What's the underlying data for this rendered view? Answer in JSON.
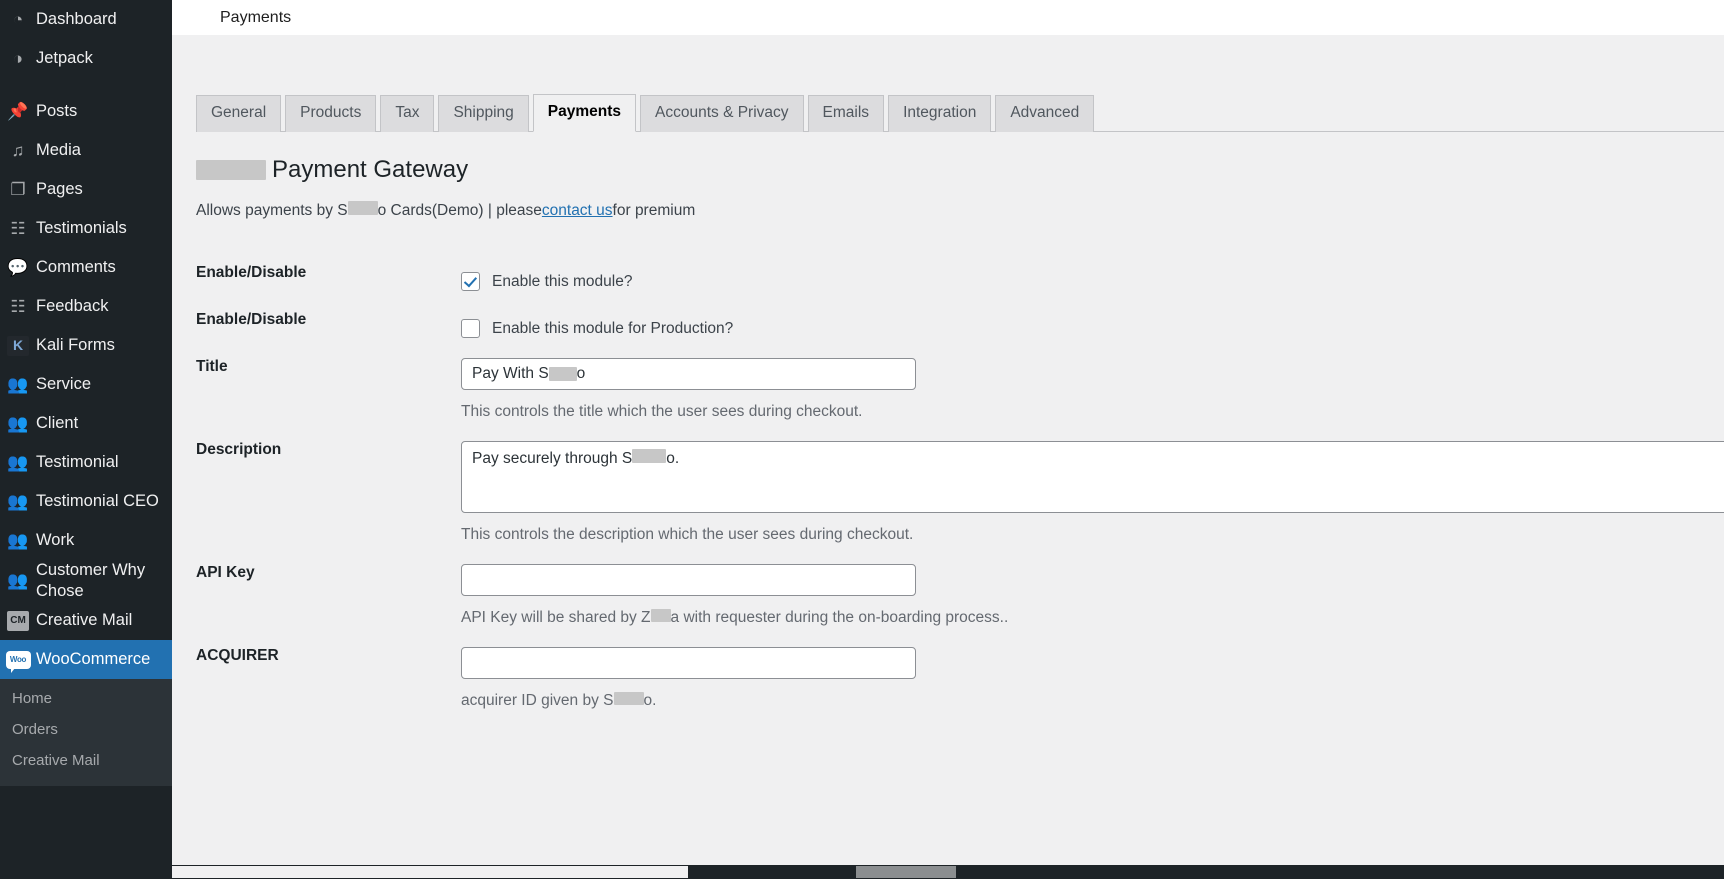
{
  "sidebar": {
    "items": [
      {
        "label": "Dashboard",
        "icon": "dashboard-icon",
        "glyph": "◔",
        "type": "icon"
      },
      {
        "label": "Jetpack",
        "icon": "jetpack-icon",
        "glyph": "◑",
        "type": "icon"
      },
      {
        "label": "Posts",
        "icon": "pin-icon",
        "glyph": "📌",
        "type": "icon",
        "gap": true
      },
      {
        "label": "Media",
        "icon": "media-icon",
        "glyph": "♫",
        "type": "icon"
      },
      {
        "label": "Pages",
        "icon": "pages-icon",
        "glyph": "❐",
        "type": "icon"
      },
      {
        "label": "Testimonials",
        "icon": "testimonials-icon",
        "glyph": "☷",
        "type": "icon"
      },
      {
        "label": "Comments",
        "icon": "comments-icon",
        "glyph": "💬",
        "type": "icon"
      },
      {
        "label": "Feedback",
        "icon": "feedback-icon",
        "glyph": "☷",
        "type": "icon"
      },
      {
        "label": "Kali Forms",
        "icon": "kali-forms-icon",
        "glyph": "K",
        "type": "badge-dark"
      },
      {
        "label": "Service",
        "icon": "group-icon",
        "glyph": "👥",
        "type": "icon"
      },
      {
        "label": "Client",
        "icon": "group-icon",
        "glyph": "👥",
        "type": "icon"
      },
      {
        "label": "Testimonial",
        "icon": "group-icon",
        "glyph": "👥",
        "type": "icon"
      },
      {
        "label": "Testimonial CEO",
        "icon": "group-icon",
        "glyph": "👥",
        "type": "icon"
      },
      {
        "label": "Work",
        "icon": "group-icon",
        "glyph": "👥",
        "type": "icon"
      },
      {
        "label": "Customer Why Chose",
        "icon": "group-icon",
        "glyph": "👥",
        "type": "icon"
      },
      {
        "label": "Creative Mail",
        "icon": "creative-mail-icon",
        "glyph": "CM",
        "type": "badge"
      },
      {
        "label": "WooCommerce",
        "icon": "woocommerce-icon",
        "glyph": "Woo",
        "type": "woo",
        "current": true
      }
    ],
    "submenu": [
      {
        "label": "Home"
      },
      {
        "label": "Orders"
      },
      {
        "label": "Creative Mail"
      }
    ]
  },
  "header": {
    "title": "Payments"
  },
  "tabs": [
    {
      "label": "General",
      "active": false
    },
    {
      "label": "Products",
      "active": false
    },
    {
      "label": "Tax",
      "active": false
    },
    {
      "label": "Shipping",
      "active": false
    },
    {
      "label": "Payments",
      "active": true
    },
    {
      "label": "Accounts & Privacy",
      "active": false
    },
    {
      "label": "Emails",
      "active": false
    },
    {
      "label": "Integration",
      "active": false
    },
    {
      "label": "Advanced",
      "active": false
    }
  ],
  "gateway": {
    "title_suffix": "Payment Gateway",
    "desc_pre": "Allows payments by S",
    "desc_mid": "o Cards(Demo) | please ",
    "desc_link": "contact us",
    "desc_post": " for premium"
  },
  "fields": {
    "enable_label": "Enable/Disable",
    "enable_module_label": "Enable this module?",
    "enable_module_checked": true,
    "enable_production_label": "Enable/Disable",
    "enable_production_text": "Enable this module for Production?",
    "enable_production_checked": false,
    "title_label": "Title",
    "title_value_pre": "Pay With S",
    "title_value_post": "o",
    "title_hint": "This controls the title which the user sees during checkout.",
    "description_label": "Description",
    "description_value_pre": "Pay securely through S",
    "description_value_post": "o.",
    "description_hint": "This controls the description which the user sees during checkout.",
    "api_key_label": "API Key",
    "api_key_value": "",
    "api_key_hint_pre": "API Key will be shared by Z",
    "api_key_hint_post": "a with requester during the on-boarding process..",
    "acquirer_label": "ACQUIRER",
    "acquirer_value": "",
    "acquirer_hint_pre": "acquirer ID given by S",
    "acquirer_hint_post": "o."
  },
  "colors": {
    "sidebar_bg": "#1d2327",
    "accent": "#2271b1",
    "content_bg": "#f0f0f1",
    "tab_bg": "#dcdcde"
  }
}
